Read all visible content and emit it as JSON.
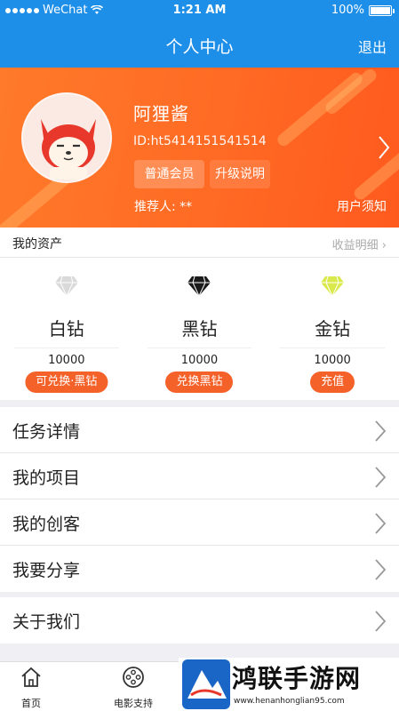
{
  "status_bar": {
    "carrier": "WeChat",
    "time": "1:21 AM",
    "battery": "100%"
  },
  "nav": {
    "title": "个人中心",
    "logout": "退出"
  },
  "profile": {
    "name": "阿狸酱",
    "id_text": "ID:ht5414151541514",
    "member_badge": "普通会员",
    "upgrade_label": "升级说明",
    "referrer": "推荐人: **",
    "notice_link": "用户须知"
  },
  "assets": {
    "title": "我的资产",
    "detail_link": "收益明细 ›",
    "diamonds": [
      {
        "name": "白钻",
        "amount": "10000",
        "action": "可兑换·黑钻",
        "color": "#d9d9d9"
      },
      {
        "name": "黑钻",
        "amount": "10000",
        "action": "兑换黑钻",
        "color": "#1a1a1a"
      },
      {
        "name": "金钻",
        "amount": "10000",
        "action": "充值",
        "color": "#d9e84a"
      }
    ]
  },
  "menu": {
    "group1": [
      {
        "label": "任务详情"
      },
      {
        "label": "我的项目"
      },
      {
        "label": "我的创客"
      },
      {
        "label": "我要分享"
      }
    ],
    "group2": [
      {
        "label": "关于我们"
      }
    ]
  },
  "tabs": [
    {
      "label": "首页",
      "icon": "home-icon"
    },
    {
      "label": "电影支持",
      "icon": "film-reel-icon"
    }
  ],
  "watermark": {
    "brand": "鸿联手游网",
    "url": "www.henanhonglian95.com"
  },
  "colors": {
    "nav_blue": "#1e8fe8",
    "orange": "#ff6a24",
    "action_orange": "#f4622a"
  }
}
